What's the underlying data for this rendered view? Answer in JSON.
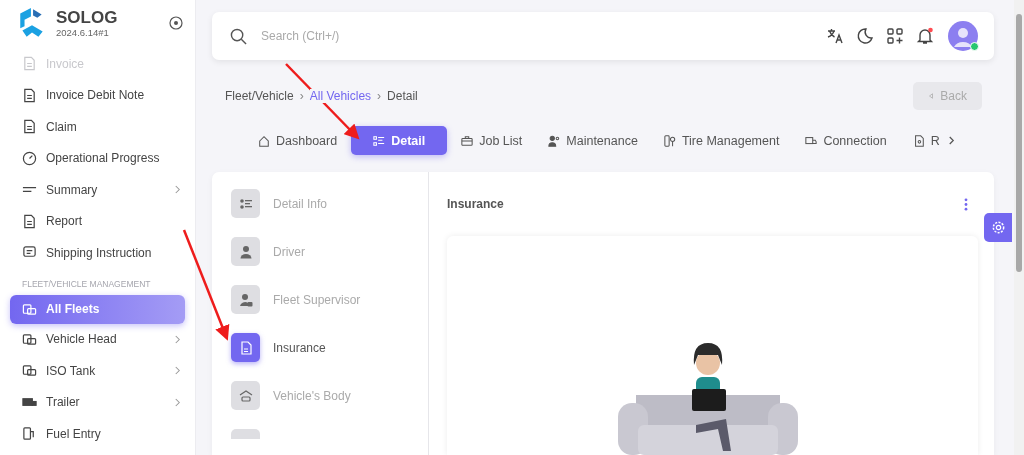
{
  "sidebar": {
    "brand": "SOLOG",
    "version": "2024.6.14#1",
    "items": [
      {
        "label": "Invoice",
        "disabled": true,
        "selected": false,
        "has_submenu": false
      },
      {
        "label": "Invoice Debit Note",
        "disabled": false,
        "selected": false,
        "has_submenu": false
      },
      {
        "label": "Claim",
        "disabled": false,
        "selected": false,
        "has_submenu": false
      },
      {
        "label": "Operational Progress",
        "disabled": false,
        "selected": false,
        "has_submenu": false
      },
      {
        "label": "Summary",
        "disabled": false,
        "selected": false,
        "has_submenu": true
      },
      {
        "label": "Report",
        "disabled": false,
        "selected": false,
        "has_submenu": false
      },
      {
        "label": "Shipping Instruction",
        "disabled": false,
        "selected": false,
        "has_submenu": false
      }
    ],
    "section": "FLEET/VEHICLE MANAGEMENT",
    "section_items": [
      {
        "label": "All Fleets",
        "disabled": false,
        "selected": true,
        "has_submenu": false
      },
      {
        "label": "Vehicle Head",
        "disabled": false,
        "selected": false,
        "has_submenu": true
      },
      {
        "label": "ISO Tank",
        "disabled": false,
        "selected": false,
        "has_submenu": true
      },
      {
        "label": "Trailer",
        "disabled": false,
        "selected": false,
        "has_submenu": true
      },
      {
        "label": "Fuel Entry",
        "disabled": false,
        "selected": false,
        "has_submenu": false
      }
    ]
  },
  "header": {
    "search": {
      "placeholder": "Search (Ctrl+/)"
    },
    "notifications_unread": true,
    "user_online": true
  },
  "breadcrumb": [
    {
      "label": "Fleet/Vehicle",
      "link": false
    },
    {
      "label": "All Vehicles",
      "link": true
    },
    {
      "label": "Detail",
      "link": false
    }
  ],
  "breadcrumb_separator": "›",
  "back_button": {
    "label": "Back",
    "disabled": true
  },
  "tabs": [
    {
      "label": "Dashboard",
      "selected": false
    },
    {
      "label": "Detail",
      "selected": true
    },
    {
      "label": "Job List",
      "selected": false
    },
    {
      "label": "Maintenance",
      "selected": false
    },
    {
      "label": "Tire Management",
      "selected": false
    },
    {
      "label": "Connection",
      "selected": false
    },
    {
      "label": "R",
      "selected": false
    }
  ],
  "detail_nav": [
    {
      "label": "Detail Info",
      "selected": false
    },
    {
      "label": "Driver",
      "selected": false
    },
    {
      "label": "Fleet Supervisor",
      "selected": false
    },
    {
      "label": "Insurance",
      "selected": true
    },
    {
      "label": "Vehicle's Body",
      "selected": false
    }
  ],
  "panel": {
    "title": "Insurance"
  }
}
